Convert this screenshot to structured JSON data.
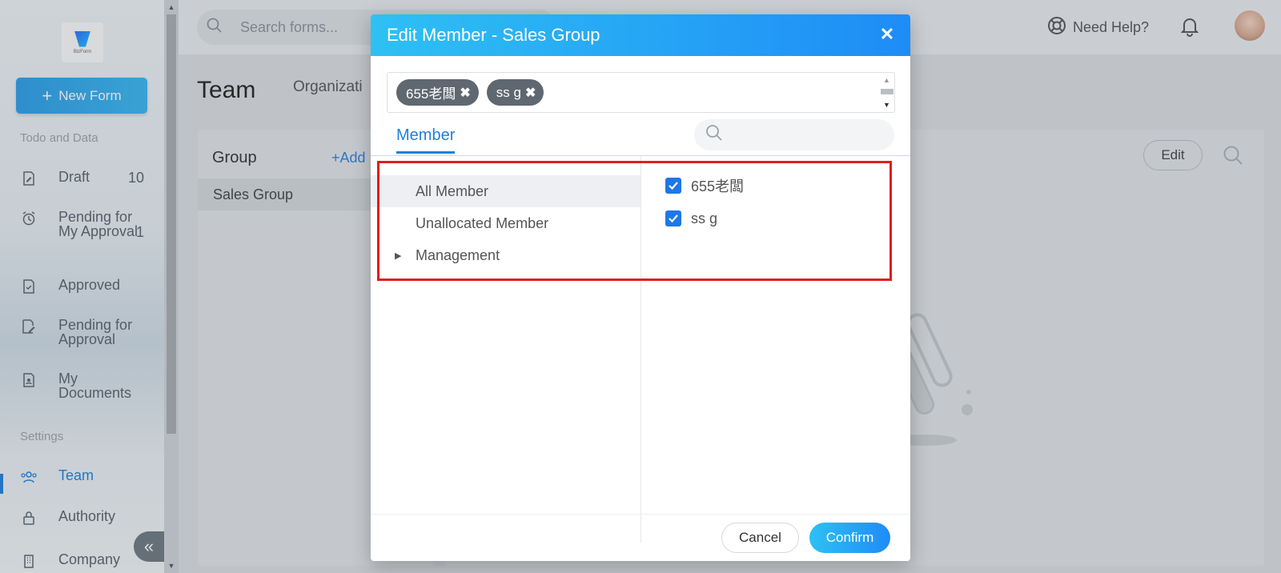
{
  "sidebar": {
    "logo_text": "BizForm",
    "new_form_label": "New Form",
    "section_todo": "Todo and Data",
    "items": [
      {
        "label": "Draft",
        "count": "10"
      },
      {
        "label": "Pending for My Approval",
        "count": "1"
      },
      {
        "label": "Approved",
        "count": ""
      },
      {
        "label": "Pending for Approval",
        "count": ""
      },
      {
        "label": "My Documents",
        "count": ""
      }
    ],
    "section_settings": "Settings",
    "settings_items": [
      {
        "label": "Team"
      },
      {
        "label": "Authority"
      },
      {
        "label": "Company"
      }
    ]
  },
  "topbar": {
    "search_placeholder": "Search forms...",
    "help_label": "Need Help?"
  },
  "page": {
    "title": "Team",
    "org_tab": "Organizati",
    "group_title": "Group",
    "group_add": "+Add",
    "group_row": "Sales Group",
    "edit_label": "Edit"
  },
  "modal": {
    "title": "Edit Member - Sales Group",
    "close": "✕",
    "tags": [
      {
        "label": "655老闆"
      },
      {
        "label": "ss g"
      }
    ],
    "tab_member": "Member",
    "tree": [
      {
        "label": "All Member",
        "selected": true
      },
      {
        "label": "Unallocated Member",
        "selected": false
      },
      {
        "label": "Management",
        "selected": false
      }
    ],
    "members": [
      {
        "label": "655老闆",
        "checked": true
      },
      {
        "label": "ss g",
        "checked": true
      }
    ],
    "cancel_label": "Cancel",
    "confirm_label": "Confirm"
  },
  "colors": {
    "accent": "#1f7fe0",
    "header_gradient_start": "#2ec0f4",
    "header_gradient_end": "#1e8cf6",
    "highlight": "#e01e1e",
    "tag_bg": "#5f6770"
  }
}
